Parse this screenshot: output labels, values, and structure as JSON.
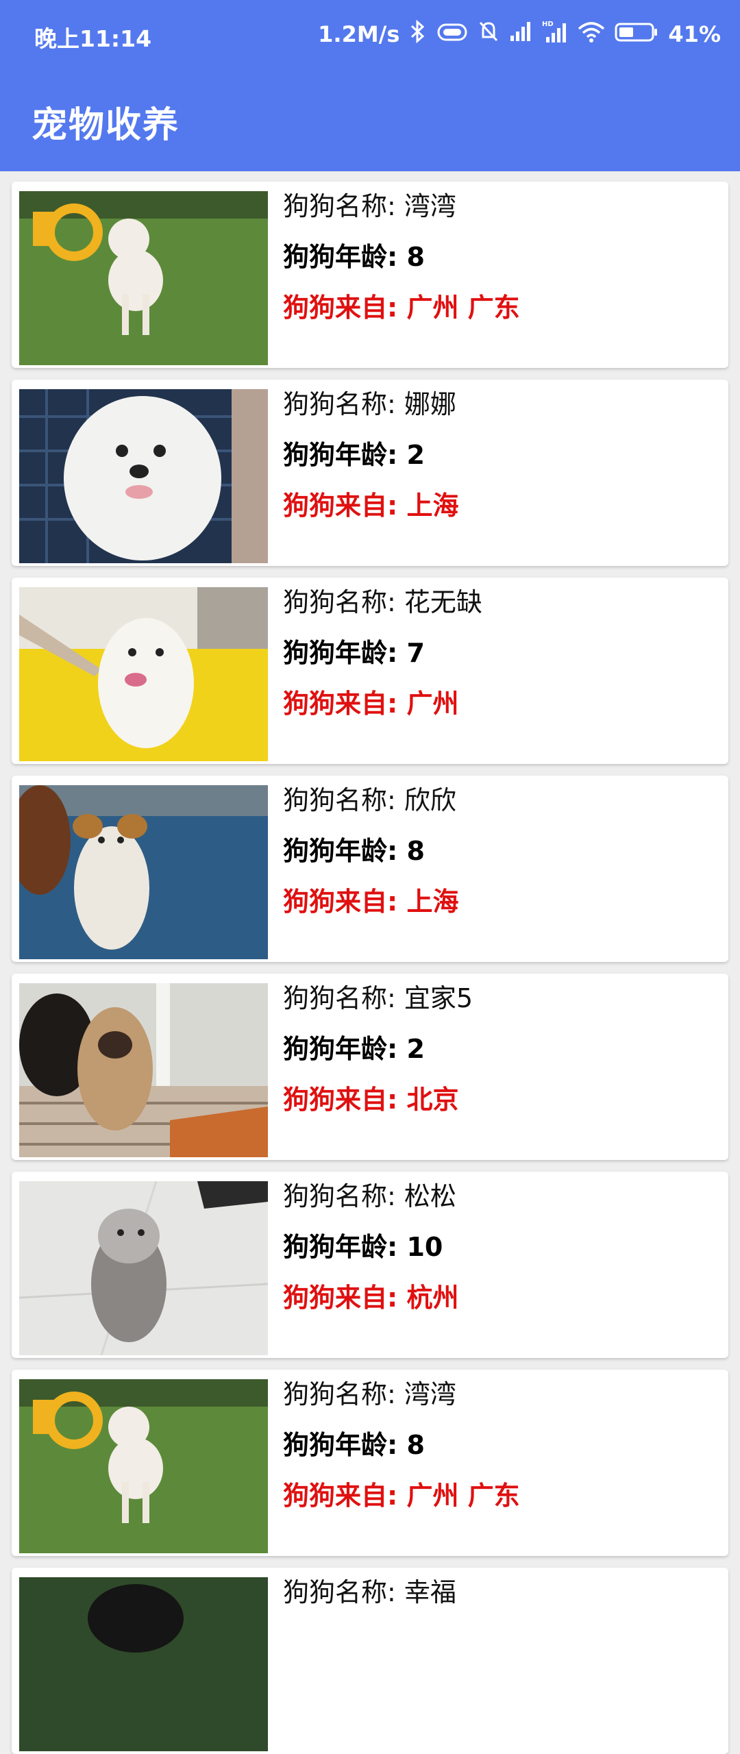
{
  "status_bar": {
    "time": "晚上11:14",
    "net_speed": "1.2M/s",
    "battery_pct": "41%",
    "icons": [
      "bluetooth-icon",
      "vibrate-icon",
      "mute-bell-icon",
      "signal-icon",
      "hd-signal-icon",
      "wifi-icon",
      "battery-icon"
    ]
  },
  "app": {
    "title": "宠物收养",
    "accent": "#5479ee"
  },
  "labels": {
    "name": "狗狗名称:",
    "age": "狗狗年龄:",
    "from": "狗狗来自:"
  },
  "pets": [
    {
      "name": "湾湾",
      "age": "8",
      "from": "广州 广东",
      "photo": "dog-on-grass"
    },
    {
      "name": "娜娜",
      "age": "2",
      "from": "上海",
      "photo": "white-fluffy-dog"
    },
    {
      "name": "花无缺",
      "age": "7",
      "from": "广州",
      "photo": "white-dog-yellow-floor"
    },
    {
      "name": "欣欣",
      "age": "8",
      "from": "上海",
      "photo": "puppy-in-tub"
    },
    {
      "name": "宜家5",
      "age": "2",
      "from": "北京",
      "photo": "puppies-on-grate"
    },
    {
      "name": "松松",
      "age": "10",
      "from": "杭州",
      "photo": "schnauzer-on-tile"
    },
    {
      "name": "湾湾",
      "age": "8",
      "from": "广州 广东",
      "photo": "dog-on-grass"
    },
    {
      "name": "幸福",
      "age": "",
      "from": "",
      "photo": "dark-dog"
    }
  ],
  "colors": {
    "from_text": "#e01010",
    "background": "#eeeeee"
  }
}
